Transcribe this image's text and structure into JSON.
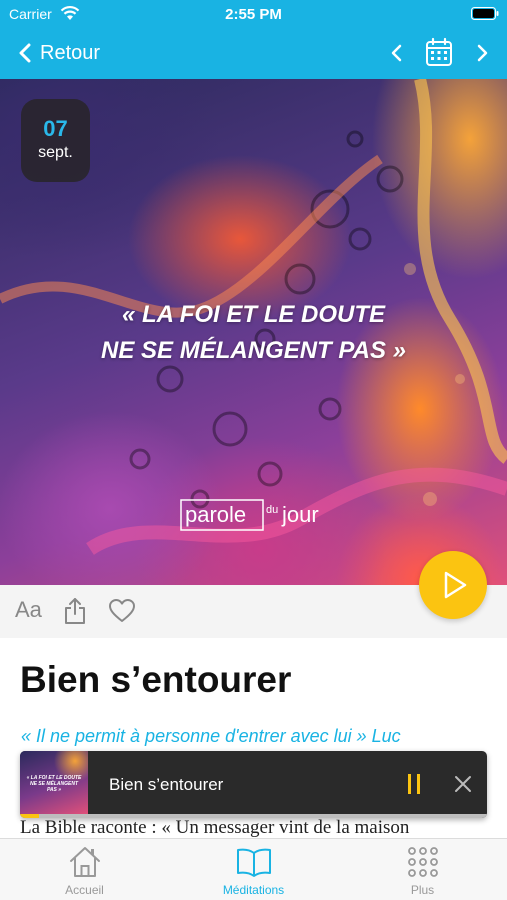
{
  "status_bar": {
    "carrier": "Carrier",
    "time": "2:55 PM"
  },
  "nav": {
    "back_label": "Retour",
    "icons": [
      "chevron-left-icon",
      "calendar-icon",
      "chevron-right-icon"
    ]
  },
  "hero": {
    "date_day": "07",
    "date_month": "sept.",
    "quote_line1": "« LA FOI ET LE DOUTE",
    "quote_line2": "NE SE MÉLANGENT PAS »",
    "logo_part1": "parole",
    "logo_part2": "du",
    "logo_part3": "jour"
  },
  "actions": {
    "font_label": "Aa",
    "icons": [
      "share-icon",
      "heart-icon",
      "play-icon"
    ]
  },
  "article": {
    "title": "Bien s’entourer",
    "verse": "« Il ne permit à personne d'entrer avec lui » Luc",
    "body_first_line": "La Bible raconte : « Un messager vint de la maison"
  },
  "mini_player": {
    "thumb_text_line1": "« LA FOI ET LE DOUTE",
    "thumb_text_line2": "NE SE MÉLANGENT PAS »",
    "title": "Bien s’entourer",
    "progress": 0.04
  },
  "tabbar": {
    "tabs": [
      {
        "label": "Accueil",
        "icon": "home-icon",
        "active": false
      },
      {
        "label": "Méditations",
        "icon": "book-icon",
        "active": true
      },
      {
        "label": "Plus",
        "icon": "grid-dots-icon",
        "active": false
      }
    ]
  },
  "colors": {
    "accent": "#19b3e3",
    "play_button": "#fbc411",
    "player_bg": "#2a2a2a"
  }
}
